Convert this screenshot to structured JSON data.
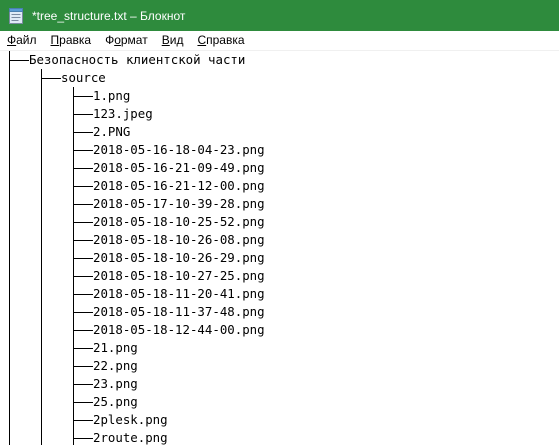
{
  "window": {
    "title": "*tree_structure.txt – Блокнот",
    "accent_color": "#2e8b3d",
    "icon": "notepad-icon"
  },
  "menu": {
    "items": [
      {
        "label": "Файл",
        "hotkey_index": 0
      },
      {
        "label": "Правка",
        "hotkey_index": 0
      },
      {
        "label": "Формат",
        "hotkey_index": 1
      },
      {
        "label": "Вид",
        "hotkey_index": 0
      },
      {
        "label": "Справка",
        "hotkey_index": 0
      }
    ]
  },
  "document": {
    "root": "Безопасность клиентской части",
    "folder": "source",
    "files": [
      "1.png",
      "123.jpeg",
      "2.PNG",
      "2018-05-16-18-04-23.png",
      "2018-05-16-21-09-49.png",
      "2018-05-16-21-12-00.png",
      "2018-05-17-10-39-28.png",
      "2018-05-18-10-25-52.png",
      "2018-05-18-10-26-08.png",
      "2018-05-18-10-26-29.png",
      "2018-05-18-10-27-25.png",
      "2018-05-18-11-20-41.png",
      "2018-05-18-11-37-48.png",
      "2018-05-18-12-44-00.png",
      "21.png",
      "22.png",
      "23.png",
      "25.png",
      "2plesk.png",
      "2route.png"
    ]
  }
}
